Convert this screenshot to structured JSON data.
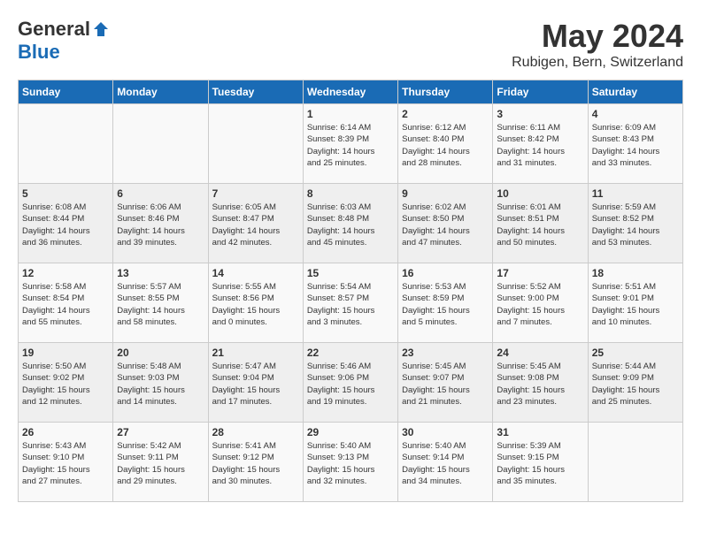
{
  "header": {
    "logo_general": "General",
    "logo_blue": "Blue",
    "month_title": "May 2024",
    "location": "Rubigen, Bern, Switzerland"
  },
  "days_of_week": [
    "Sunday",
    "Monday",
    "Tuesday",
    "Wednesday",
    "Thursday",
    "Friday",
    "Saturday"
  ],
  "weeks": [
    [
      {
        "num": "",
        "info": ""
      },
      {
        "num": "",
        "info": ""
      },
      {
        "num": "",
        "info": ""
      },
      {
        "num": "1",
        "info": "Sunrise: 6:14 AM\nSunset: 8:39 PM\nDaylight: 14 hours\nand 25 minutes."
      },
      {
        "num": "2",
        "info": "Sunrise: 6:12 AM\nSunset: 8:40 PM\nDaylight: 14 hours\nand 28 minutes."
      },
      {
        "num": "3",
        "info": "Sunrise: 6:11 AM\nSunset: 8:42 PM\nDaylight: 14 hours\nand 31 minutes."
      },
      {
        "num": "4",
        "info": "Sunrise: 6:09 AM\nSunset: 8:43 PM\nDaylight: 14 hours\nand 33 minutes."
      }
    ],
    [
      {
        "num": "5",
        "info": "Sunrise: 6:08 AM\nSunset: 8:44 PM\nDaylight: 14 hours\nand 36 minutes."
      },
      {
        "num": "6",
        "info": "Sunrise: 6:06 AM\nSunset: 8:46 PM\nDaylight: 14 hours\nand 39 minutes."
      },
      {
        "num": "7",
        "info": "Sunrise: 6:05 AM\nSunset: 8:47 PM\nDaylight: 14 hours\nand 42 minutes."
      },
      {
        "num": "8",
        "info": "Sunrise: 6:03 AM\nSunset: 8:48 PM\nDaylight: 14 hours\nand 45 minutes."
      },
      {
        "num": "9",
        "info": "Sunrise: 6:02 AM\nSunset: 8:50 PM\nDaylight: 14 hours\nand 47 minutes."
      },
      {
        "num": "10",
        "info": "Sunrise: 6:01 AM\nSunset: 8:51 PM\nDaylight: 14 hours\nand 50 minutes."
      },
      {
        "num": "11",
        "info": "Sunrise: 5:59 AM\nSunset: 8:52 PM\nDaylight: 14 hours\nand 53 minutes."
      }
    ],
    [
      {
        "num": "12",
        "info": "Sunrise: 5:58 AM\nSunset: 8:54 PM\nDaylight: 14 hours\nand 55 minutes."
      },
      {
        "num": "13",
        "info": "Sunrise: 5:57 AM\nSunset: 8:55 PM\nDaylight: 14 hours\nand 58 minutes."
      },
      {
        "num": "14",
        "info": "Sunrise: 5:55 AM\nSunset: 8:56 PM\nDaylight: 15 hours\nand 0 minutes."
      },
      {
        "num": "15",
        "info": "Sunrise: 5:54 AM\nSunset: 8:57 PM\nDaylight: 15 hours\nand 3 minutes."
      },
      {
        "num": "16",
        "info": "Sunrise: 5:53 AM\nSunset: 8:59 PM\nDaylight: 15 hours\nand 5 minutes."
      },
      {
        "num": "17",
        "info": "Sunrise: 5:52 AM\nSunset: 9:00 PM\nDaylight: 15 hours\nand 7 minutes."
      },
      {
        "num": "18",
        "info": "Sunrise: 5:51 AM\nSunset: 9:01 PM\nDaylight: 15 hours\nand 10 minutes."
      }
    ],
    [
      {
        "num": "19",
        "info": "Sunrise: 5:50 AM\nSunset: 9:02 PM\nDaylight: 15 hours\nand 12 minutes."
      },
      {
        "num": "20",
        "info": "Sunrise: 5:48 AM\nSunset: 9:03 PM\nDaylight: 15 hours\nand 14 minutes."
      },
      {
        "num": "21",
        "info": "Sunrise: 5:47 AM\nSunset: 9:04 PM\nDaylight: 15 hours\nand 17 minutes."
      },
      {
        "num": "22",
        "info": "Sunrise: 5:46 AM\nSunset: 9:06 PM\nDaylight: 15 hours\nand 19 minutes."
      },
      {
        "num": "23",
        "info": "Sunrise: 5:45 AM\nSunset: 9:07 PM\nDaylight: 15 hours\nand 21 minutes."
      },
      {
        "num": "24",
        "info": "Sunrise: 5:45 AM\nSunset: 9:08 PM\nDaylight: 15 hours\nand 23 minutes."
      },
      {
        "num": "25",
        "info": "Sunrise: 5:44 AM\nSunset: 9:09 PM\nDaylight: 15 hours\nand 25 minutes."
      }
    ],
    [
      {
        "num": "26",
        "info": "Sunrise: 5:43 AM\nSunset: 9:10 PM\nDaylight: 15 hours\nand 27 minutes."
      },
      {
        "num": "27",
        "info": "Sunrise: 5:42 AM\nSunset: 9:11 PM\nDaylight: 15 hours\nand 29 minutes."
      },
      {
        "num": "28",
        "info": "Sunrise: 5:41 AM\nSunset: 9:12 PM\nDaylight: 15 hours\nand 30 minutes."
      },
      {
        "num": "29",
        "info": "Sunrise: 5:40 AM\nSunset: 9:13 PM\nDaylight: 15 hours\nand 32 minutes."
      },
      {
        "num": "30",
        "info": "Sunrise: 5:40 AM\nSunset: 9:14 PM\nDaylight: 15 hours\nand 34 minutes."
      },
      {
        "num": "31",
        "info": "Sunrise: 5:39 AM\nSunset: 9:15 PM\nDaylight: 15 hours\nand 35 minutes."
      },
      {
        "num": "",
        "info": ""
      }
    ]
  ]
}
